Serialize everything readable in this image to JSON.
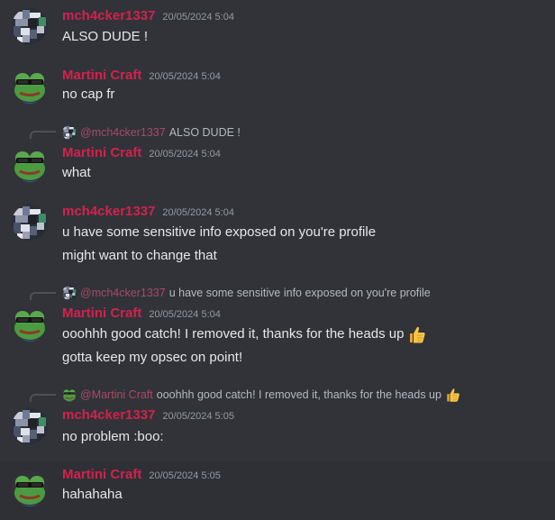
{
  "users": {
    "mch": {
      "name": "mch4cker1337",
      "mention": "@mch4cker1337",
      "avatar_icon": "pixel-glitch-avatar-icon"
    },
    "martini": {
      "name": "Martini Craft",
      "mention": "@Martini Craft",
      "avatar_icon": "pepe-frog-sunglasses-icon"
    }
  },
  "colors": {
    "background": "#313338",
    "hover_background": "#2e3035",
    "username": "#d3214f",
    "timestamp": "#949ba4",
    "text": "#e6e7e9",
    "reply_text": "#b5bac1"
  },
  "messages": [
    {
      "author": "mch4cker1337",
      "timestamp": "20/05/2024 5:04",
      "lines": [
        "ALSO DUDE !"
      ]
    },
    {
      "author": "Martini Craft",
      "timestamp": "20/05/2024 5:04",
      "lines": [
        "no cap fr"
      ]
    },
    {
      "author": "Martini Craft",
      "timestamp": "20/05/2024 5:04",
      "lines": [
        "what"
      ],
      "reply": {
        "mention": "@mch4cker1337",
        "text": "ALSO DUDE !"
      }
    },
    {
      "author": "mch4cker1337",
      "timestamp": "20/05/2024 5:04",
      "lines": [
        "u have some sensitive info exposed on you're profile",
        "might want to change that"
      ]
    },
    {
      "author": "Martini Craft",
      "timestamp": "20/05/2024 5:04",
      "lines": [
        "ooohhh good catch! I removed it, thanks for the heads up",
        "gotta keep my opsec on point!"
      ],
      "emoji": "thumbs-up-icon",
      "reply": {
        "mention": "@mch4cker1337",
        "text": "u have some sensitive info exposed on you're profile"
      }
    },
    {
      "author": "mch4cker1337",
      "timestamp": "20/05/2024 5:05",
      "lines": [
        "no problem :boo:"
      ],
      "reply": {
        "mention": "@Martini Craft",
        "text": "ooohhh good catch! I removed it, thanks for the heads up",
        "emoji": "thumbs-up-icon"
      }
    },
    {
      "author": "Martini Craft",
      "timestamp": "20/05/2024 5:05",
      "lines": [
        "hahahaha"
      ]
    }
  ]
}
